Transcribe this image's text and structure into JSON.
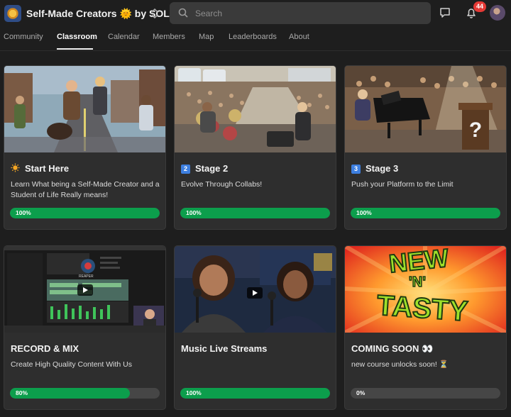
{
  "header": {
    "group_name": "Self-Made Creators 🌞 by SOL",
    "search_placeholder": "Search",
    "notification_count": "44"
  },
  "nav": {
    "tabs": [
      "Community",
      "Classroom",
      "Calendar",
      "Members",
      "Map",
      "Leaderboards",
      "About"
    ],
    "active": "Classroom"
  },
  "courses": [
    {
      "title": "Start Here",
      "prefix": "🌞",
      "description": "Learn What being a Self-Made Creator and a Student of Life Really means!",
      "progress_label": "100%",
      "progress": 100
    },
    {
      "title": "Stage 2",
      "prefix": "2",
      "description": "Evolve Through Collabs!",
      "progress_label": "100%",
      "progress": 100
    },
    {
      "title": "Stage 3",
      "prefix": "3",
      "description": "Push your Platform to the Limit",
      "progress_label": "100%",
      "progress": 100
    },
    {
      "title": "RECORD & MIX",
      "prefix": "",
      "description": "Create High Quality Content With Us",
      "progress_label": "80%",
      "progress": 80
    },
    {
      "title": "Music Live Streams",
      "prefix": "",
      "description": "",
      "progress_label": "100%",
      "progress": 100
    },
    {
      "title": "COMING SOON 👀",
      "prefix": "",
      "description": "new course unlocks soon! ⏳",
      "progress_label": "0%",
      "progress": 0
    }
  ],
  "thumbnails": {
    "reaper_logo_text": "REAPER",
    "new_n_tasty": [
      "NEW",
      "'N'",
      "TASTY"
    ]
  },
  "colors": {
    "background": "#1e1e1e",
    "card": "#2e2e2e",
    "progress_fill": "#0c9e4c",
    "badge": "#e53935"
  }
}
